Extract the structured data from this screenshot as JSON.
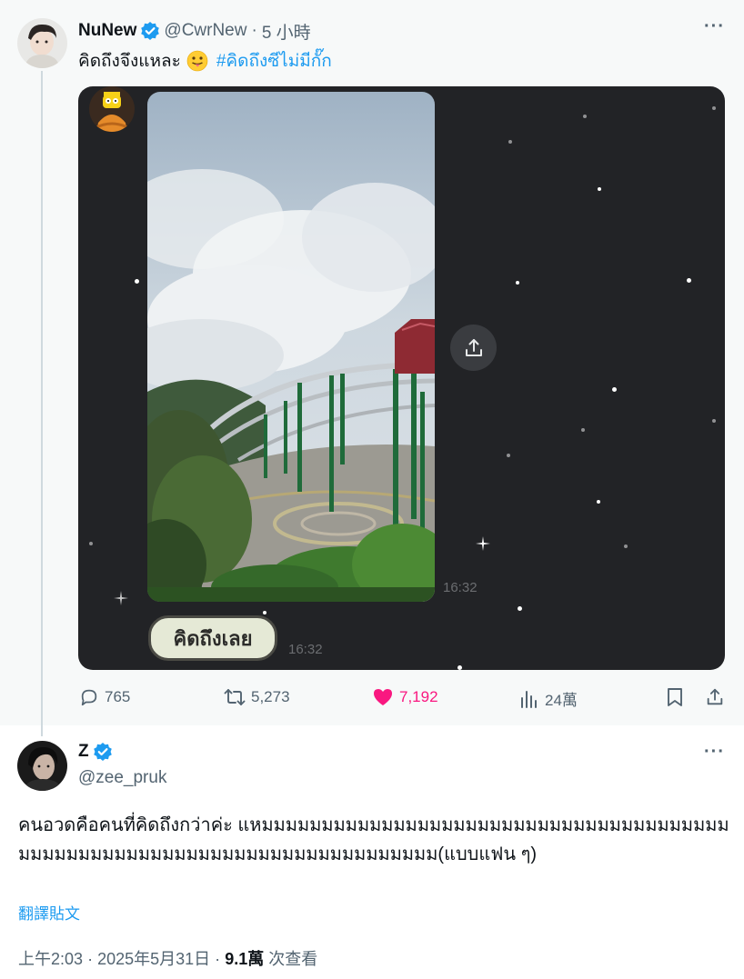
{
  "parent": {
    "author_name": "NuNew",
    "handle": "@CwrNew",
    "separator": "·",
    "time": "5 小時",
    "more": "···",
    "text": "คิดถึงจึงแหละ",
    "emoji": "face-with-tongue",
    "hashtag": "#คิดถึงซีไม่มีกั๊ก",
    "media": {
      "timestamp_photo": "16:32",
      "timestamp_sticker": "16:32",
      "sticker_text": "คิดถึงเลย"
    },
    "stats": {
      "replies": "765",
      "reposts": "5,273",
      "likes": "7,192",
      "views": "24萬"
    }
  },
  "reply": {
    "author_name": "Z",
    "handle": "@zee_pruk",
    "more": "···",
    "text": "คนอวดคือคนที่คิดถึงกว่าค่ะ แหมมมมมมมมมมมมมมมมมมมมมมมมมมมมมมมมมมมมมมมมมมมมมมมมมมมมมมมมมมมมมมมมมมมมมมมมมม(แบบแฟน ๆ)",
    "translate": "翻譯貼文",
    "time": "上午2:03",
    "separator": "·",
    "date": "2025年5月31日",
    "separator2": "·",
    "views": "9.1萬",
    "views_label": "次查看"
  },
  "colors": {
    "accent": "#1d9bf0",
    "like": "#f91880",
    "muted": "#536471",
    "media_bg": "#222326"
  }
}
